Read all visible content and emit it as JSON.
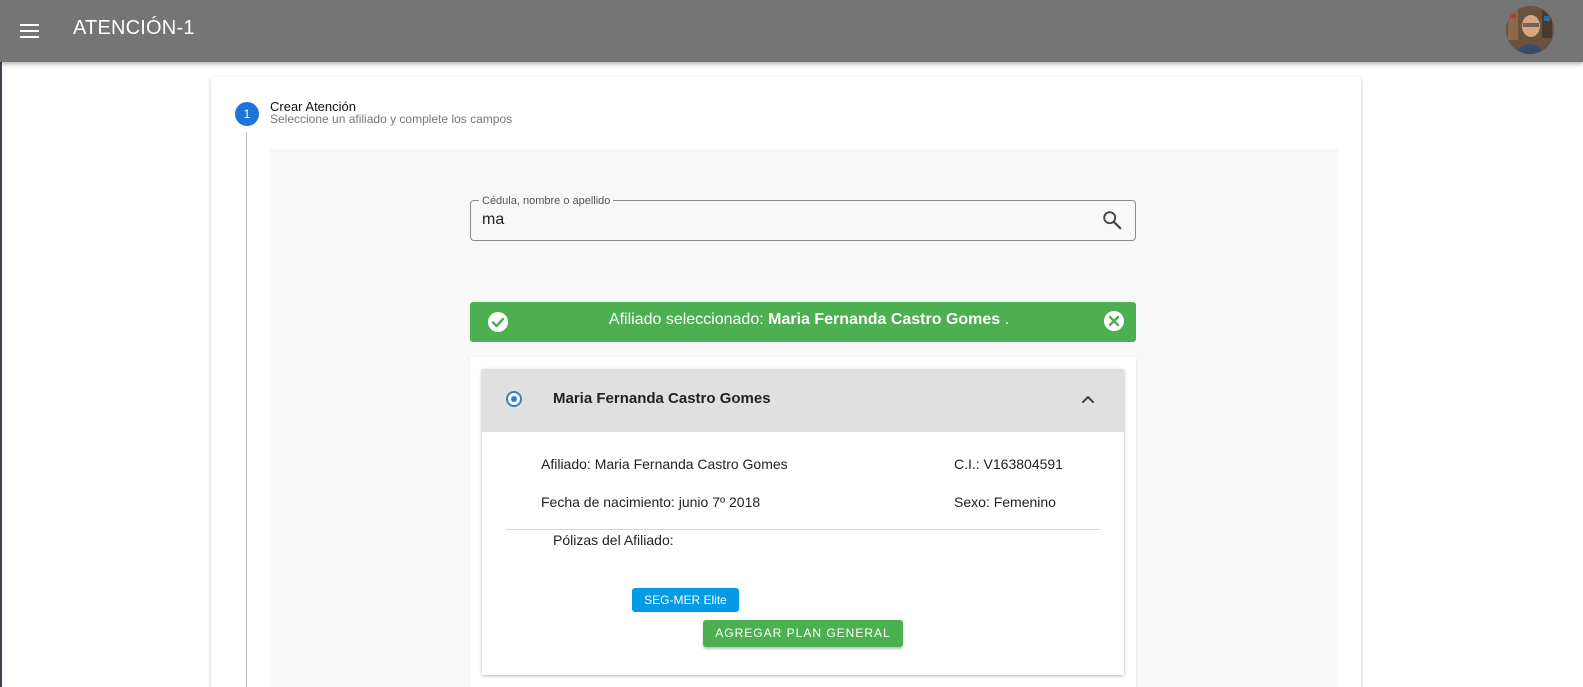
{
  "appbar": {
    "title": "ATENCIÓN-1",
    "menu_icon": "menu-icon",
    "avatar_icon": "user-avatar"
  },
  "stepper": {
    "step_number": "1",
    "step_title": "Crear Atención",
    "step_subtitle": "Seleccione un afiliado y complete los campos"
  },
  "search": {
    "label": "Cédula, nombre o apellido",
    "value": "ma",
    "icon": "search-icon"
  },
  "alert": {
    "prefix": "Afiliado seleccionado: ",
    "name": "Maria Fernanda Castro Gomes",
    "suffix": " .",
    "color": "#4caf50"
  },
  "affiliate": {
    "header_name": "Maria Fernanda Castro Gomes",
    "afiliado_line": "Afiliado: Maria Fernanda Castro Gomes",
    "ci_line": "C.I.: V163804591",
    "birth_line": "Fecha de nacimiento: junio 7º 2018",
    "sex_line": "Sexo: Femenino",
    "polizas_label": "Pólizas del Afiliado:",
    "polizas": [
      "SEG-MER Elite"
    ],
    "add_button": "AGREGAR PLAN GENERAL"
  },
  "colors": {
    "appbar": "#757575",
    "primary": "#1e74d8",
    "success": "#4caf50",
    "chip": "#039be5"
  }
}
